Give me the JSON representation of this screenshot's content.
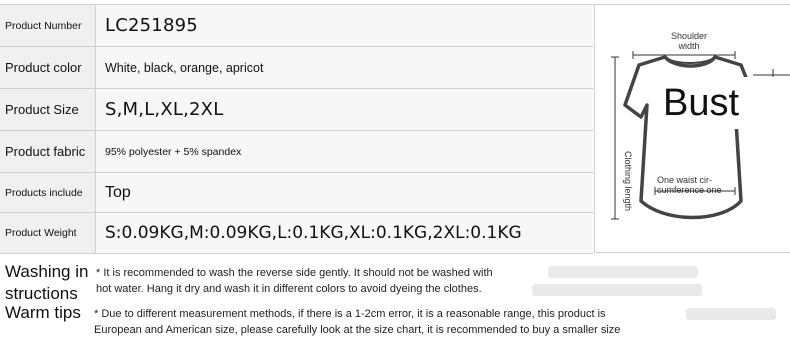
{
  "spec_rows": [
    {
      "label": "Product Number",
      "value": "LC251895"
    },
    {
      "label": "Product color",
      "value": "White, black, orange, apricot"
    },
    {
      "label": "Product Size",
      "value": "S,M,L,XL,2XL"
    },
    {
      "label": "Product fabric",
      "value": "95% polyester + 5% spandex"
    },
    {
      "label": "Products include",
      "value": "Top"
    },
    {
      "label": "Product Weight",
      "value": "S:0.09KG,M:0.09KG,L:0.1KG,XL:0.1KG,2XL:0.1KG"
    }
  ],
  "figure": {
    "shoulder_width_line1": "Shoulder",
    "shoulder_width_line2": "width",
    "bust": "Bust",
    "clothing_length": "Clothing length",
    "waist_line1": "One waist cir-",
    "waist_line2": "cumference one",
    "icon": "t-shirt-outline-icon"
  },
  "notes": {
    "washing_title_line1": "Washing in",
    "washing_title_line2": "structions",
    "washing_line1": "* It is recommended to wash the reverse side gently. It should not be washed with",
    "washing_line2": "hot water. Hang it dry and wash it in different colors to avoid dyeing the clothes.",
    "warm_title": "Warm tips",
    "warm_line1": "* Due to different measurement methods, if there is a 1-2cm error, it is a reasonable range, this product is",
    "warm_line2": "European and American size, please carefully look at the size chart, it is recommended to buy a smaller size"
  }
}
